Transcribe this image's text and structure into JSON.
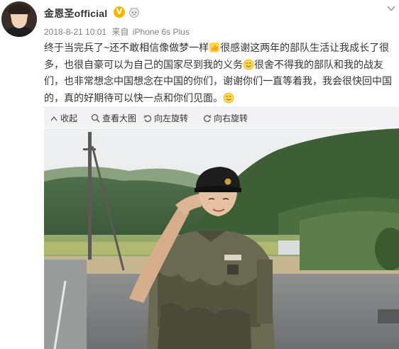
{
  "post": {
    "username": "金恩圣official",
    "verified_badge": "V",
    "timestamp": "2018-8-21 10:01",
    "source_prefix": "来自",
    "source_device": "iPhone 6s Plus",
    "content_segments": [
      "终于当完兵了~还不敢相信像做梦一样",
      "很感谢这两年的部队生活让我成长了很多，也很自豪可以为自己的国家尽到我的义务",
      "很舍不得我的部队和我的战友们，也非常想念中国想念在中国的你们，谢谢你们一直等着我，我会很快回中国的，真的好期待可以快一点和你们见面。"
    ],
    "emoji_icons": [
      "thumbs-emoji",
      "smile-emoji",
      "smile-emoji"
    ]
  },
  "toolbar": {
    "collapse_label": "收起",
    "view_large_label": "查看大图",
    "rotate_left_label": "向左旋转",
    "rotate_right_label": "向右旋转"
  },
  "colors": {
    "username": "#333333",
    "meta": "#808080",
    "badge": "#f7b500",
    "toolbar_bg": "#f2f2f5"
  },
  "icons": {
    "more": "chevron-down-icon",
    "collapse": "collapse-icon",
    "view_large": "zoom-icon",
    "rotate_left": "rotate-left-icon",
    "rotate_right": "rotate-right-icon"
  }
}
